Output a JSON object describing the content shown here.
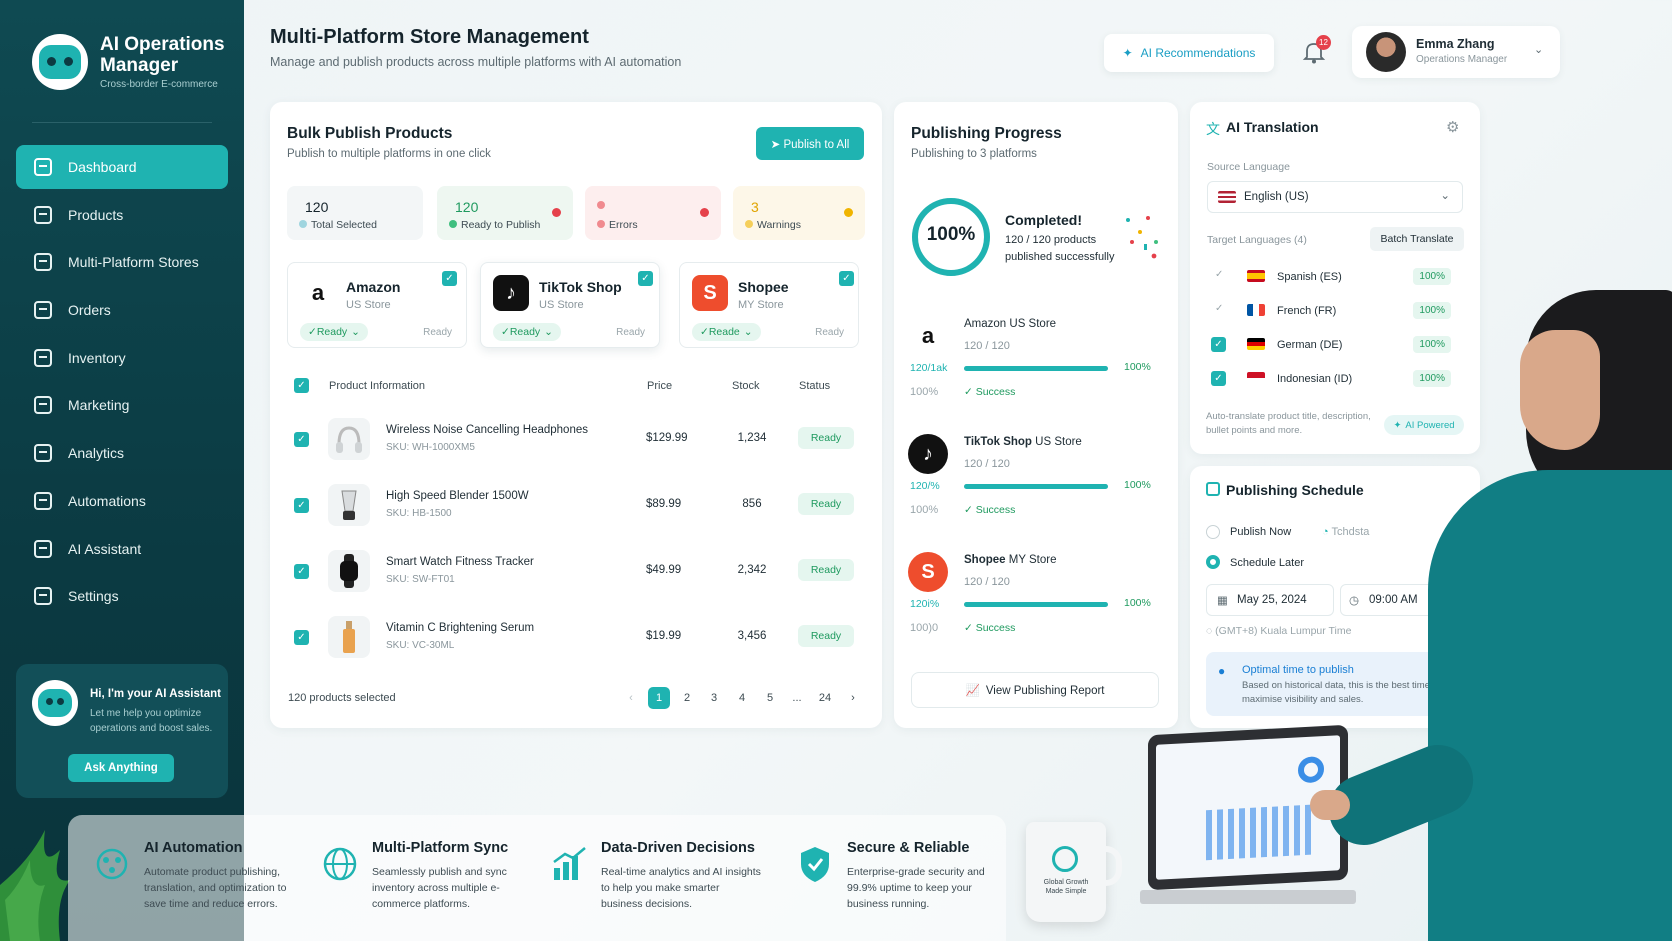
{
  "app": {
    "title": "AI Operations Manager",
    "subtitle": "Cross-border E-commerce"
  },
  "sidebar": {
    "items": [
      {
        "label": "Dashboard",
        "icon": "dashboard-icon",
        "active": true
      },
      {
        "label": "Products",
        "icon": "box-icon"
      },
      {
        "label": "Multi-Platform Stores",
        "icon": "store-icon"
      },
      {
        "label": "Orders",
        "icon": "orders-icon"
      },
      {
        "label": "Inventory",
        "icon": "inventory-icon"
      },
      {
        "label": "Marketing",
        "icon": "megaphone-icon"
      },
      {
        "label": "Analytics",
        "icon": "chart-icon"
      },
      {
        "label": "Automations",
        "icon": "gears-icon"
      },
      {
        "label": "AI Assistant",
        "icon": "brain-icon"
      },
      {
        "label": "Settings",
        "icon": "gear-icon"
      }
    ],
    "assistant": {
      "title": "Hi, I'm your AI Assistant",
      "text": "Let me help you optimize operations and boost sales.",
      "button": "Ask Anything"
    }
  },
  "header": {
    "title": "Multi-Platform Store Management",
    "subtitle": "Manage and publish products across multiple platforms with AI automation",
    "ai_button": "AI Recommendations",
    "notifications": "12",
    "user": {
      "name": "Emma Zhang",
      "role": "Operations Manager"
    }
  },
  "bulk": {
    "title": "Bulk Publish Products",
    "subtitle": "Publish to multiple platforms in one click",
    "publish_button": "Publish to All",
    "stats": [
      {
        "value": "120",
        "label": "Total Selected"
      },
      {
        "value": "120",
        "label": "Ready to Publish"
      },
      {
        "value": "",
        "label": "Errors"
      },
      {
        "value": "3",
        "label": "Warnings"
      }
    ],
    "platforms": [
      {
        "name": "Amazon",
        "region": "US Store",
        "status": "Ready",
        "status2": "Ready"
      },
      {
        "name": "TikTok Shop",
        "region": "US Store",
        "status": "Ready",
        "status2": "Ready"
      },
      {
        "name": "Shopee",
        "region": "MY Store",
        "status": "Reade",
        "status2": "Ready"
      }
    ],
    "columns": {
      "info": "Product Information",
      "price": "Price",
      "stock": "Stock",
      "status": "Status"
    },
    "products": [
      {
        "name": "Wireless Noise Cancelling Headphones",
        "sku": "SKU: WH-1000XM5",
        "price": "$129.99",
        "stock": "1,234",
        "status": "Ready"
      },
      {
        "name": "High Speed Blender 1500W",
        "sku": "SKU: HB-1500",
        "price": "$89.99",
        "stock": "856",
        "status": "Ready"
      },
      {
        "name": "Smart Watch Fitness Tracker",
        "sku": "SKU: SW-FT01",
        "price": "$49.99",
        "stock": "2,342",
        "status": "Ready"
      },
      {
        "name": "Vitamin C Brightening Serum",
        "sku": "SKU: VC-30ML",
        "price": "$19.99",
        "stock": "3,456",
        "status": "Ready"
      }
    ],
    "footer": "120 products selected",
    "pages": [
      "1",
      "2",
      "3",
      "4",
      "5",
      "...",
      "24"
    ]
  },
  "progress": {
    "title": "Publishing Progress",
    "subtitle": "Publishing to 3 platforms",
    "percent": "100%",
    "done_title": "Completed!",
    "done_count": "120 / 120 products",
    "done_text": "published successfully",
    "stores": [
      {
        "name": "Amazon",
        "region": "US Store",
        "count": "120 / 120",
        "pct": "100%",
        "fill": 1.0,
        "blur1": "120/1ak",
        "blur2": "100%",
        "status": "Success"
      },
      {
        "name": "TikTok Shop",
        "region": "US Store",
        "count": "120 / 120",
        "pct": "100%",
        "fill": 1.0,
        "blur1": "120/%",
        "blur2": "100%",
        "status": "Success"
      },
      {
        "name": "Shopee",
        "region": "MY Store",
        "count": "120 / 120",
        "pct": "100%",
        "fill": 1.0,
        "blur1": "120i%",
        "blur2": "100)0",
        "status": "Success"
      }
    ],
    "report_button": "View Publishing Report"
  },
  "translation": {
    "title": "AI Translation",
    "source_label": "Source Language",
    "source_value": "English (US)",
    "target_label": "Target Languages (4)",
    "batch_button": "Batch Translate",
    "languages": [
      {
        "name": "Spanish (ES)",
        "pct": "100%",
        "flag": "#e8b400"
      },
      {
        "name": "French (FR)",
        "pct": "100%",
        "flag": "#2b4eb8"
      },
      {
        "name": "German (DE)",
        "pct": "100%",
        "flag": "#222222"
      },
      {
        "name": "Indonesian (ID)",
        "pct": "100%",
        "flag": "#d8262c"
      }
    ],
    "note": "Auto-translate product title, description, bullet points and more.",
    "powered": "AI Powered"
  },
  "schedule": {
    "title": "Publishing Schedule",
    "now_label": "Publish Now",
    "schedule_badge": "Tchdsta",
    "later_label": "Schedule Later",
    "date": "May 25, 2024",
    "time": "09:00 AM",
    "timezone": "(GMT+8) Kuala Lumpur Time",
    "tip_title": "Optimal time to publish",
    "tip_text": "Based on historical data, this is the best time to maximise visibility and sales."
  },
  "features": [
    {
      "title": "AI Automation",
      "text": "Automate product publishing, translation, and optimization to save time and reduce errors."
    },
    {
      "title": "Multi-Platform Sync",
      "text": "Seamlessly publish and sync inventory across multiple e-commerce platforms."
    },
    {
      "title": "Data-Driven Decisions",
      "text": "Real-time analytics and AI insights to help you make smarter business decisions."
    },
    {
      "title": "Secure & Reliable",
      "text": "Enterprise-grade security and 99.9% uptime to keep your business running."
    }
  ],
  "mug_text": "Global Growth Made Simple",
  "colors": {
    "accent": "#1fb3b1",
    "sidebar": "#0b3a42",
    "success": "#1f9a5f",
    "error": "#e5414b",
    "warning": "#f0b400"
  }
}
